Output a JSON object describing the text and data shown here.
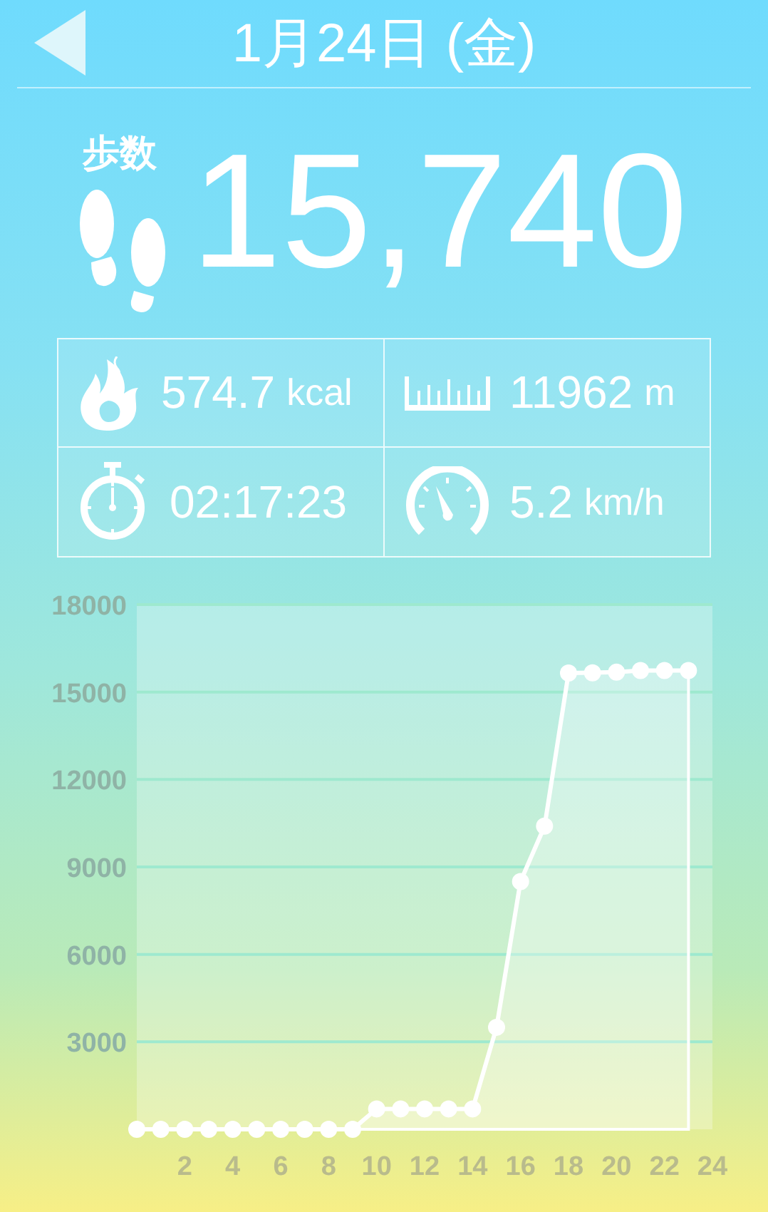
{
  "header": {
    "title": "1月24日 (金)"
  },
  "steps": {
    "label": "歩数",
    "value": "15,740"
  },
  "stats": [
    {
      "kind": "calories",
      "value": "574.7",
      "unit": "kcal"
    },
    {
      "kind": "distance",
      "value": "11962",
      "unit": "m"
    },
    {
      "kind": "time",
      "value": "02:17:23"
    },
    {
      "kind": "speed",
      "value": "5.2",
      "unit": "km/h"
    }
  ],
  "chart": {
    "chart_data": {
      "type": "area",
      "x": [
        0,
        1,
        2,
        3,
        4,
        5,
        6,
        7,
        8,
        9,
        10,
        11,
        12,
        13,
        14,
        15,
        16,
        17,
        18,
        19,
        20,
        21,
        22,
        23
      ],
      "grid": true,
      "series": [
        {
          "color": "#ffffff",
          "values": [
            0,
            0,
            0,
            0,
            0,
            0,
            0,
            0,
            0,
            0,
            700,
            700,
            700,
            700,
            700,
            3500,
            8500,
            10400,
            15650,
            15660,
            15680,
            15740,
            15740,
            15740
          ]
        }
      ],
      "xlim": [
        0,
        24
      ],
      "ylim": [
        0,
        18000
      ],
      "xticks": [
        2,
        4,
        6,
        8,
        10,
        12,
        14,
        16,
        18,
        20,
        22,
        24
      ],
      "yticks": [
        3000,
        6000,
        9000,
        12000,
        15000,
        18000
      ]
    }
  }
}
